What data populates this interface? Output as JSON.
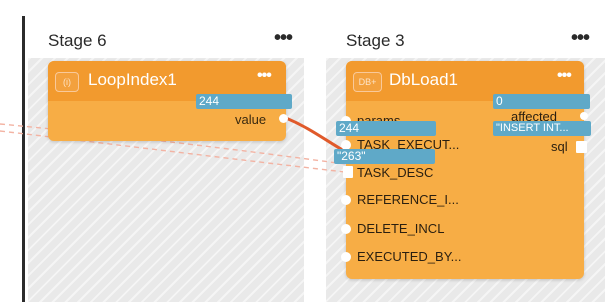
{
  "colors": {
    "stage_bg": "#e9e9e9",
    "node_body": "#f7ad45",
    "node_header": "#f29a2e",
    "value_pill": "#5fa9c8",
    "wire": "#e05a2b"
  },
  "stages": [
    {
      "title": "Stage 6",
      "more": "•••"
    },
    {
      "title": "Stage 3",
      "more": "•••"
    }
  ],
  "loop_node": {
    "badge": "(i)",
    "title": "LoopIndex1",
    "more": "•••",
    "value_label": "value",
    "value_pill": "244"
  },
  "db_node": {
    "badge": "DB+",
    "title": "DbLoad1",
    "more": "•••",
    "outputs": [
      {
        "label": "affected",
        "pill": "0"
      },
      {
        "label": "sql",
        "pill": "\"INSERT INT..."
      }
    ],
    "params": [
      {
        "label": "params",
        "pill": "244"
      },
      {
        "label": "TASK_EXECUT...",
        "pill": "\"263\""
      },
      {
        "label": "TASK_DESC"
      },
      {
        "label": "REFERENCE_I..."
      },
      {
        "label": "DELETE_INCL"
      },
      {
        "label": "EXECUTED_BY..."
      }
    ]
  }
}
